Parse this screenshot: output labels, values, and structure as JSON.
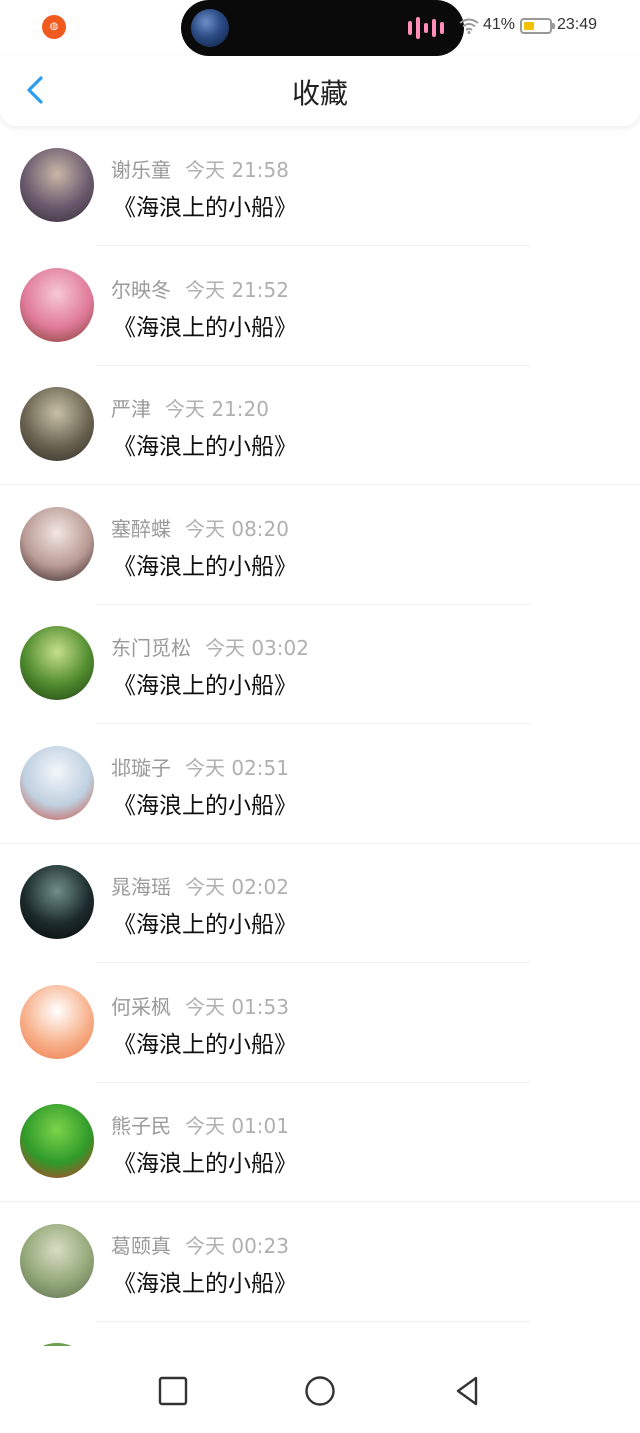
{
  "status_bar": {
    "battery_percent": "41%",
    "time": "23:49",
    "battery_level": 0.41,
    "icons": [
      "app-notification-icon",
      "island-avatar",
      "audio-wave-icon",
      "wifi-icon",
      "battery-icon"
    ]
  },
  "header": {
    "title": "收藏",
    "back_icon": "chevron-left-icon",
    "accent_color": "#2a9cf4"
  },
  "favorites": [
    {
      "user": "谢乐童",
      "time": "今天 21:58",
      "title": "《海浪上的小船》",
      "avatar_colors": [
        "#c9b7a8",
        "#6b5a6e",
        "#2f2832"
      ]
    },
    {
      "user": "尔映冬",
      "time": "今天 21:52",
      "title": "《海浪上的小船》",
      "avatar_colors": [
        "#f6c9d3",
        "#e07a9a",
        "#7a3b2a"
      ]
    },
    {
      "user": "严津",
      "time": "今天 21:20",
      "title": "《海浪上的小船》",
      "avatar_colors": [
        "#c8c0a8",
        "#6a6350",
        "#2b2a24"
      ]
    },
    {
      "user": "塞醉蝶",
      "time": "今天 08:20",
      "title": "《海浪上的小船》",
      "avatar_colors": [
        "#f2e6e2",
        "#b99a94",
        "#2b1e1e"
      ]
    },
    {
      "user": "东门觅松",
      "time": "今天 03:02",
      "title": "《海浪上的小船》",
      "avatar_colors": [
        "#c6e08a",
        "#4f8a2e",
        "#1f3d12"
      ]
    },
    {
      "user": "邶璇子",
      "time": "今天 02:51",
      "title": "《海浪上的小船》",
      "avatar_colors": [
        "#f3f6f9",
        "#bfd0e0",
        "#c94a3a"
      ]
    },
    {
      "user": "晁海瑶",
      "time": "今天 02:02",
      "title": "《海浪上的小船》",
      "avatar_colors": [
        "#6f8f8a",
        "#1c2a2c",
        "#050808"
      ]
    },
    {
      "user": "何采枫",
      "time": "今天 01:53",
      "title": "《海浪上的小船》",
      "avatar_colors": [
        "#ffffff",
        "#f7b08a",
        "#f07848"
      ]
    },
    {
      "user": "熊子民",
      "time": "今天 01:01",
      "title": "《海浪上的小船》",
      "avatar_colors": [
        "#7cd44a",
        "#2f9a2a",
        "#d6322a"
      ]
    },
    {
      "user": "葛颐真",
      "time": "今天 00:23",
      "title": "《海浪上的小船》",
      "avatar_colors": [
        "#d9dcc4",
        "#93a878",
        "#5a6a4e"
      ]
    }
  ],
  "nav_bar": {
    "icons": [
      "recent-apps-icon",
      "home-icon",
      "back-icon"
    ]
  }
}
